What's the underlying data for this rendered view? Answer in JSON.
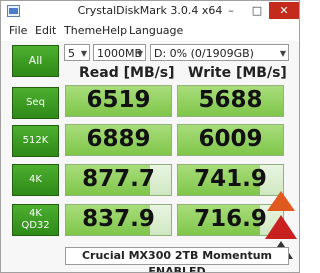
{
  "window": {
    "title": "CrystalDiskMark 3.0.4 x64"
  },
  "window_controls": {
    "minimize": "–",
    "maximize": "□",
    "close": "✕"
  },
  "menu": [
    "File",
    "Edit",
    "Theme",
    "Help",
    "Language"
  ],
  "controls": {
    "count": "5",
    "size": "1000MB",
    "drive": "D: 0% (0/1909GB)"
  },
  "columns": {
    "read": "Read [MB/s]",
    "write": "Write [MB/s]"
  },
  "tests": [
    {
      "label": "All"
    },
    {
      "label": "Seq",
      "read": "6519",
      "write": "5688",
      "read_fill": 1.0,
      "write_fill": 1.0
    },
    {
      "label": "512K",
      "read": "6889",
      "write": "6009",
      "read_fill": 1.0,
      "write_fill": 1.0
    },
    {
      "label": "4K",
      "read": "877.7",
      "write": "741.9",
      "read_fill": 0.8,
      "write_fill": 0.78
    },
    {
      "label": "4K\nQD32",
      "label_line1": "4K",
      "label_line2": "QD32",
      "read": "837.9",
      "write": "716.9",
      "read_fill": 0.8,
      "write_fill": 0.78
    }
  ],
  "footer": {
    "text": "Crucial MX300 2TB Momentum ENABLED"
  },
  "icons": {
    "app": "crystaldiskmark-icon",
    "dropdown": "chevron-down-icon"
  },
  "colors": {
    "accent": "#3f9f22",
    "cell_fill": "#8fd156",
    "close": "#c42b1c"
  }
}
